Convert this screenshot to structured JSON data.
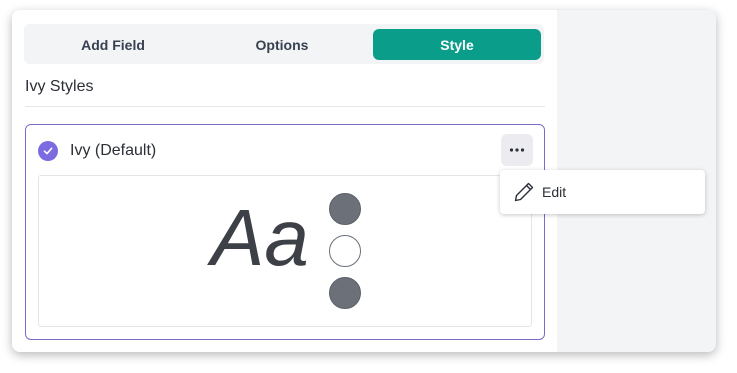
{
  "tabs": [
    {
      "label": "Add Field",
      "active": false
    },
    {
      "label": "Options",
      "active": false
    },
    {
      "label": "Style",
      "active": true
    }
  ],
  "section": {
    "title": "Ivy Styles"
  },
  "style_card": {
    "name": "Ivy (Default)",
    "selected": true,
    "preview_text": "Aa",
    "swatches": [
      "filled",
      "empty",
      "filled"
    ],
    "swatch_color": "#6b7079"
  },
  "context_menu": {
    "items": [
      {
        "label": "Edit",
        "icon": "pencil-icon"
      }
    ]
  },
  "colors": {
    "accent": "#0a9d8a",
    "selected_border": "#7a6bc8",
    "check": "#7c6be0"
  }
}
